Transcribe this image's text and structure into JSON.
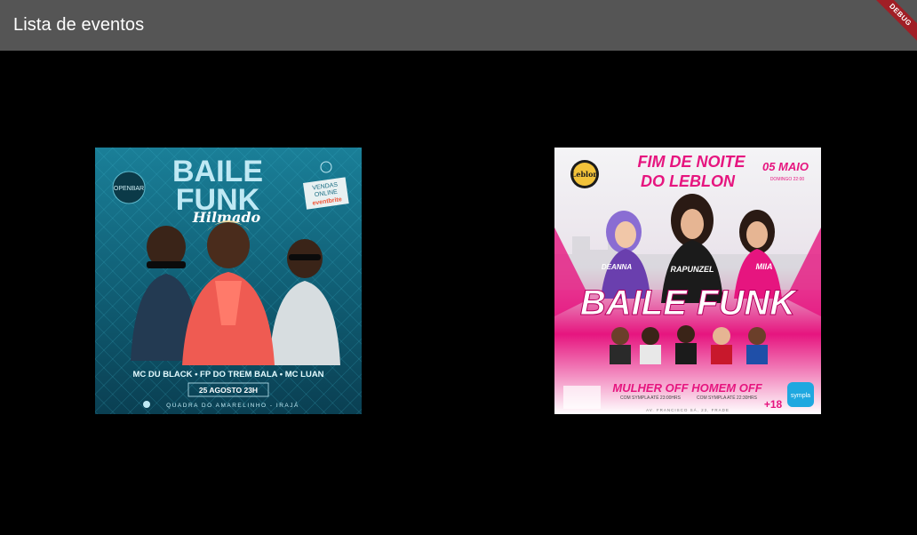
{
  "app": {
    "title": "Lista de eventos",
    "debug_label": "DEBUG"
  },
  "events": [
    {
      "poster": {
        "badge": "OPENBAR",
        "title_line1": "BAILE",
        "title_line2": "FUNK",
        "subtitle": "Hilmado",
        "ticket_line1": "VENDAS",
        "ticket_line2": "ONLINE",
        "ticket_brand": "eventbrite",
        "artists": "MC DU BLACK • FP DO TREM BALA • MC LUAN",
        "date": "25 AGOSTO 23H",
        "venue": "QUADRA DO AMARELINHO - IRAJÁ"
      }
    },
    {
      "poster": {
        "logo": "Leblon",
        "title_line1": "FIM DE NOITE",
        "title_line2": "DO LEBLON",
        "date": "05 MAIO",
        "day": "DOMINGO 22:00",
        "names_top": [
          "DEANNA",
          "RAPUNZEL",
          "MIIA"
        ],
        "headline": "BAILE FUNK",
        "women_price": "MULHER OFF",
        "women_note": "COM SYMPLA ATÉ 23:00HRS",
        "men_price": "HOMEM OFF",
        "men_note": "COM SYMPLA ATÉ 22:30HRS",
        "age": "+18",
        "brand": "sympla",
        "address": "AV. FRANCISCO SÁ, 23, FRADE"
      }
    }
  ],
  "colors": {
    "appbar": "#555555",
    "background": "#000000",
    "debug": "#a01f26",
    "poster1_bg": "#0f5a70",
    "poster2_accent": "#e6157f"
  }
}
